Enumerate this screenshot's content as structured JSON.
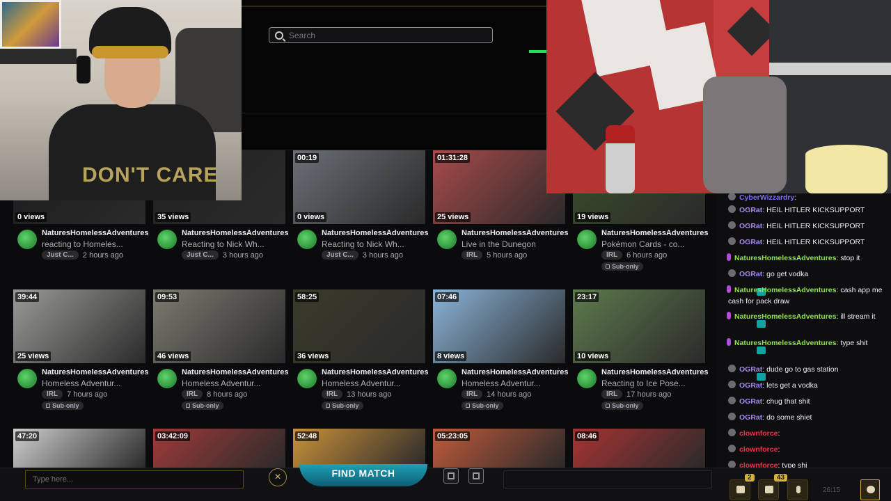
{
  "screenshare": {
    "search_placeholder": "Search"
  },
  "cam_left": {
    "hoodie_text": "DON'T CARE"
  },
  "rows": [
    [
      {
        "duration": "",
        "views": "0 views",
        "channel": "NaturesHomelessAdventures",
        "title": "reacting to Homeles...",
        "tag": "Just C...",
        "ago": "2 hours ago",
        "sub": ""
      },
      {
        "duration": "",
        "views": "35 views",
        "channel": "NaturesHomelessAdventures",
        "title": "Reacting to Nick Wh...",
        "tag": "Just C...",
        "ago": "3 hours ago",
        "sub": ""
      },
      {
        "duration": "00:19",
        "views": "0 views",
        "channel": "NaturesHomelessAdventures",
        "title": "Reacting to Nick Wh...",
        "tag": "Just C...",
        "ago": "3 hours ago",
        "sub": ""
      },
      {
        "duration": "01:31:28",
        "views": "25 views",
        "channel": "NaturesHomelessAdventures",
        "title": "Live in the Dunegon",
        "tag": "IRL",
        "ago": "5 hours ago",
        "sub": ""
      },
      {
        "duration": "",
        "views": "19 views",
        "channel": "NaturesHomelessAdventures",
        "title": "Pokémon Cards - co...",
        "tag": "IRL",
        "ago": "6 hours ago",
        "sub": "Sub-only"
      }
    ],
    [
      {
        "duration": "39:44",
        "views": "25 views",
        "channel": "NaturesHomelessAdventures",
        "title": "Homeless Adventur...",
        "tag": "IRL",
        "ago": "7 hours ago",
        "sub": "Sub-only"
      },
      {
        "duration": "09:53",
        "views": "46 views",
        "channel": "NaturesHomelessAdventures",
        "title": "Homeless Adventur...",
        "tag": "IRL",
        "ago": "8 hours ago",
        "sub": "Sub-only"
      },
      {
        "duration": "58:25",
        "views": "36 views",
        "channel": "NaturesHomelessAdventures",
        "title": "Homeless Adventur...",
        "tag": "IRL",
        "ago": "13 hours ago",
        "sub": "Sub-only"
      },
      {
        "duration": "07:46",
        "views": "8 views",
        "channel": "NaturesHomelessAdventures",
        "title": "Homeless Adventur...",
        "tag": "IRL",
        "ago": "14 hours ago",
        "sub": "Sub-only"
      },
      {
        "duration": "23:17",
        "views": "10 views",
        "channel": "NaturesHomelessAdventures",
        "title": "Reacting to Ice Pose...",
        "tag": "IRL",
        "ago": "17 hours ago",
        "sub": "Sub-only"
      }
    ],
    [
      {
        "duration": "47:20"
      },
      {
        "duration": "03:42:09"
      },
      {
        "duration": "52:48"
      },
      {
        "duration": "05:23:05"
      },
      {
        "duration": "08:46"
      }
    ]
  ],
  "chat": [
    {
      "user": "CyberWizzardry",
      "sep": ":",
      "text": "",
      "type": "cy"
    },
    {
      "user": "OGRat",
      "sep": ":",
      "text": "HEIL HITLER KICKSUPPORT",
      "type": "og"
    },
    {
      "user": "OGRat",
      "sep": ":",
      "text": "HEIL HITLER KICKSUPPORT",
      "type": "og"
    },
    {
      "user": "OGRat",
      "sep": ":",
      "text": "HEIL HITLER KICKSUPPORT",
      "type": "og"
    },
    {
      "user": "NaturesHomelessAdventures",
      "sep": ":",
      "text": "stop it",
      "type": "nat"
    },
    {
      "user": "OGRat",
      "sep": ":",
      "text": "go get vodka",
      "type": "og"
    },
    {
      "user": "NaturesHomelessAdventures",
      "sep": ":",
      "text": "cash app me cash for pack draw",
      "type": "nat"
    },
    {
      "user": "NaturesHomelessAdventures",
      "sep": ":",
      "text": "ill stream it",
      "type": "nat"
    },
    {
      "user": "NaturesHomelessAdventures",
      "sep": ":",
      "text": "type shit",
      "type": "nat"
    },
    {
      "user": "OGRat",
      "sep": ":",
      "text": "dude go to gas station",
      "type": "og"
    },
    {
      "user": "OGRat",
      "sep": ":",
      "text": "lets get a vodka",
      "type": "og"
    },
    {
      "user": "OGRat",
      "sep": ":",
      "text": "chug that shit",
      "type": "og"
    },
    {
      "user": "OGRat",
      "sep": ":",
      "text": "do some shiet",
      "type": "og"
    },
    {
      "user": "clownforce",
      "sep": ":",
      "text": "",
      "type": "cl"
    },
    {
      "user": "clownforce",
      "sep": ":",
      "text": "",
      "type": "cl"
    },
    {
      "user": "clownforce",
      "sep": ":",
      "text": "type shi",
      "type": "cl"
    }
  ],
  "bottombar": {
    "chat_placeholder": "Type here...",
    "close_label": "×",
    "find_match_label": "FIND MATCH",
    "count_1": "2",
    "count_2": "43",
    "clock": "26:15"
  }
}
